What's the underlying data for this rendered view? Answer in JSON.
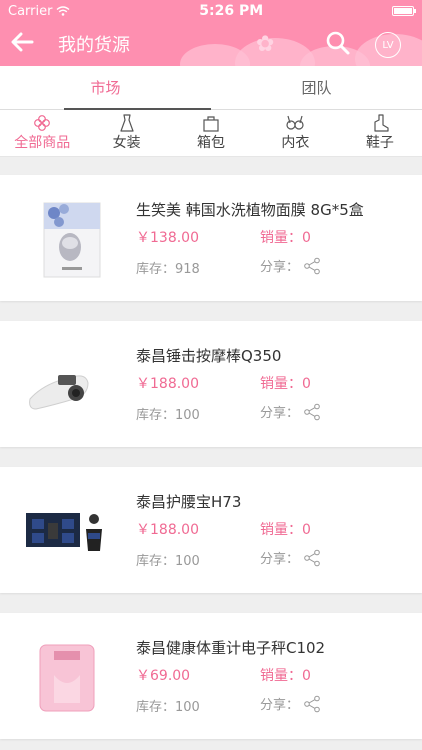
{
  "status": {
    "carrier": "Carrier",
    "time": "5:26 PM"
  },
  "nav": {
    "title": "我的货源",
    "avatar_text": "LV"
  },
  "tabs": [
    {
      "label": "市场"
    },
    {
      "label": "团队"
    }
  ],
  "categories": [
    {
      "label": "全部商品",
      "icon": "flower-icon"
    },
    {
      "label": "女装",
      "icon": "dress-icon"
    },
    {
      "label": "箱包",
      "icon": "bag-icon"
    },
    {
      "label": "内衣",
      "icon": "bra-icon"
    },
    {
      "label": "鞋子",
      "icon": "boot-icon"
    }
  ],
  "labels": {
    "sales": "销量：",
    "stock": "库存：",
    "share": "分享："
  },
  "products": [
    {
      "name": "生笑美 韩国水洗植物面膜 8G*5盒",
      "price": "￥138.00",
      "sales": "0",
      "stock": "918"
    },
    {
      "name": "泰昌锤击按摩棒Q350",
      "price": "￥188.00",
      "sales": "0",
      "stock": "100"
    },
    {
      "name": "泰昌护腰宝H73",
      "price": "￥188.00",
      "sales": "0",
      "stock": "100"
    },
    {
      "name": "泰昌健康体重计电子秤C102",
      "price": "￥69.00",
      "sales": "0",
      "stock": "100"
    }
  ],
  "colors": {
    "brand_pink": "#fe8fb0",
    "accent_pink": "#f06a93",
    "gray_text": "#999999"
  }
}
